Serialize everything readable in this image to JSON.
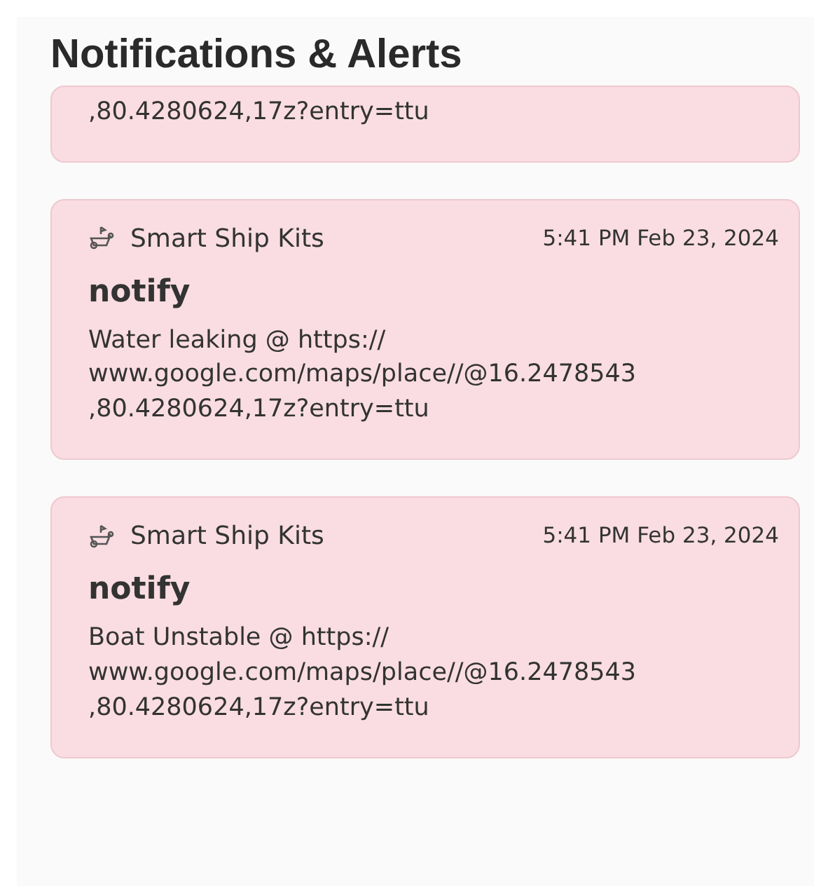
{
  "header": {
    "title": "Notifications & Alerts"
  },
  "notifications": [
    {
      "message": ",80.4280624,17z?entry=ttu"
    },
    {
      "app": "Smart Ship Kits",
      "time": "5:41 PM Feb 23, 2024",
      "title": "notify",
      "message": "Water leaking @ https://\nwww.google.com/maps/place//@16.2478543\n,80.4280624,17z?entry=ttu"
    },
    {
      "app": "Smart Ship Kits",
      "time": "5:41 PM Feb 23, 2024",
      "title": "notify",
      "message": "Boat Unstable @ https://\nwww.google.com/maps/place//@16.2478543\n,80.4280624,17z?entry=ttu"
    }
  ]
}
